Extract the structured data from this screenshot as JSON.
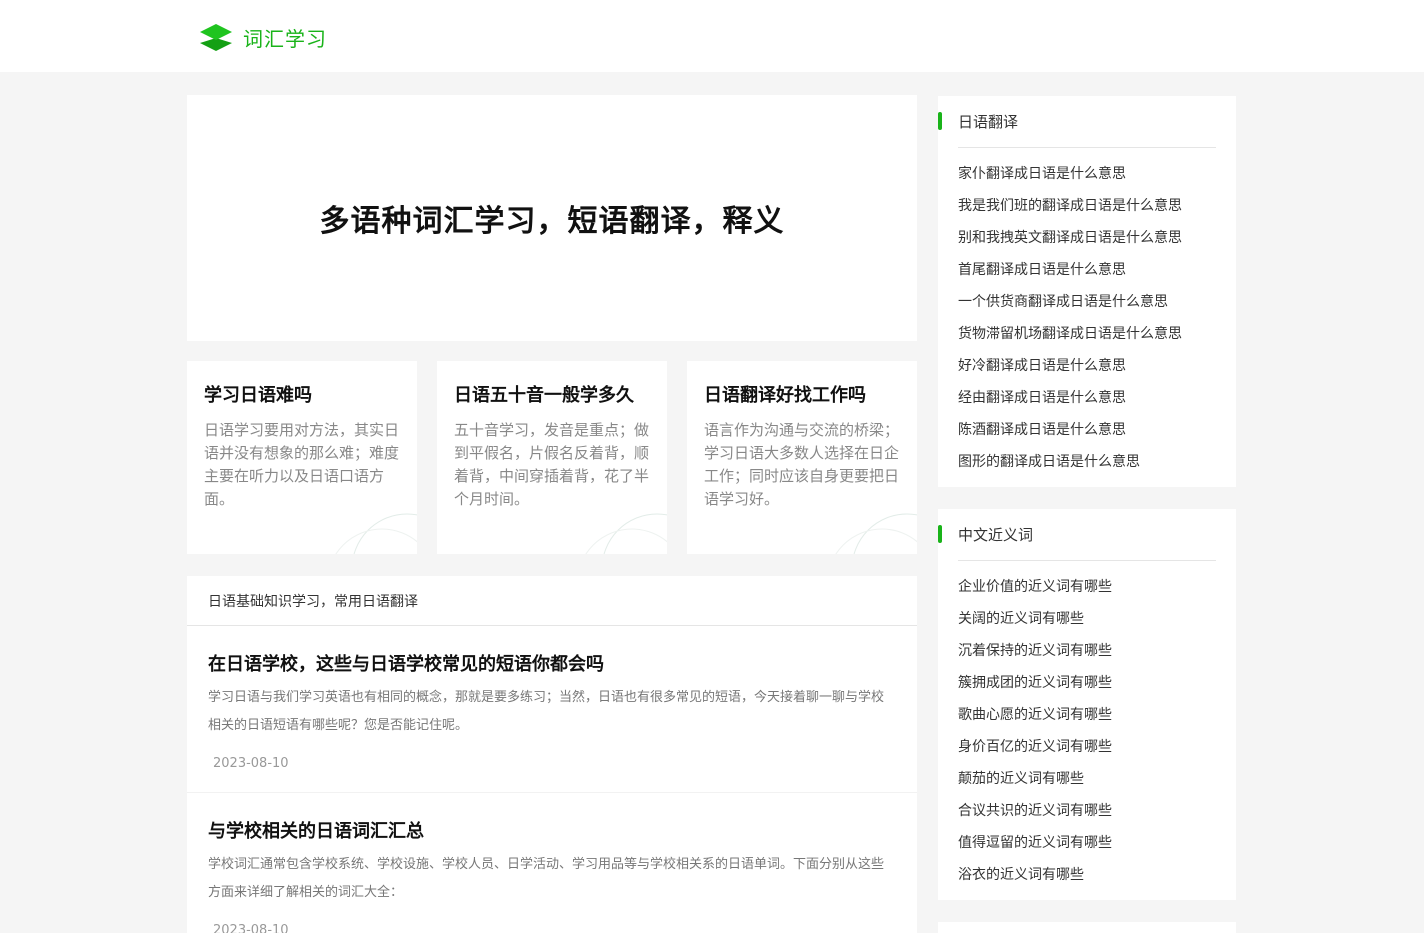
{
  "site": {
    "logo_text": "词汇学习",
    "accent": "#19b319"
  },
  "hero": {
    "title": "多语种词汇学习，短语翻译，释义"
  },
  "cards": [
    {
      "title": "学习日语难吗",
      "desc": "日语学习要用对方法，其实日语并没有想象的那么难；难度主要在听力以及日语口语方面。"
    },
    {
      "title": "日语五十音一般学多久",
      "desc": "五十音学习，发音是重点；做到平假名，片假名反着背，顺着背，中间穿插着背，花了半个月时间。"
    },
    {
      "title": "日语翻译好找工作吗",
      "desc": "语言作为沟通与交流的桥梁；学习日语大多数人选择在日企工作；同时应该自身更要把日语学习好。"
    }
  ],
  "article_list": {
    "heading": "日语基础知识学习，常用日语翻译",
    "items": [
      {
        "title": "在日语学校，这些与日语学校常见的短语你都会吗",
        "excerpt": "学习日语与我们学习英语也有相同的概念，那就是要多练习；当然，日语也有很多常见的短语，今天接着聊一聊与学校相关的日语短语有哪些呢？您是否能记住呢。",
        "date": "2023-08-10"
      },
      {
        "title": "与学校相关的日语词汇汇总",
        "excerpt": "学校词汇通常包含学校系统、学校设施、学校人员、日学活动、学习用品等与学校相关系的日语单词。下面分别从这些方面来详细了解相关的词汇大全：",
        "date": "2023-08-10"
      }
    ]
  },
  "sidebar": {
    "japanese": {
      "heading": "日语翻译",
      "items": [
        "家仆翻译成日语是什么意思",
        "我是我们班的翻译成日语是什么意思",
        "别和我拽英文翻译成日语是什么意思",
        "首尾翻译成日语是什么意思",
        "一个供货商翻译成日语是什么意思",
        "货物滞留机场翻译成日语是什么意思",
        "好冷翻译成日语是什么意思",
        "经由翻译成日语是什么意思",
        "陈酒翻译成日语是什么意思",
        "图形的翻译成日语是什么意思"
      ]
    },
    "synonyms": {
      "heading": "中文近义词",
      "items": [
        "企业价值的近义词有哪些",
        "关阔的近义词有哪些",
        "沉着保持的近义词有哪些",
        "簇拥成团的近义词有哪些",
        "歌曲心愿的近义词有哪些",
        "身价百亿的近义词有哪些",
        "颠茄的近义词有哪些",
        "合议共识的近义词有哪些",
        "值得逗留的近义词有哪些",
        "浴衣的近义词有哪些"
      ]
    }
  }
}
